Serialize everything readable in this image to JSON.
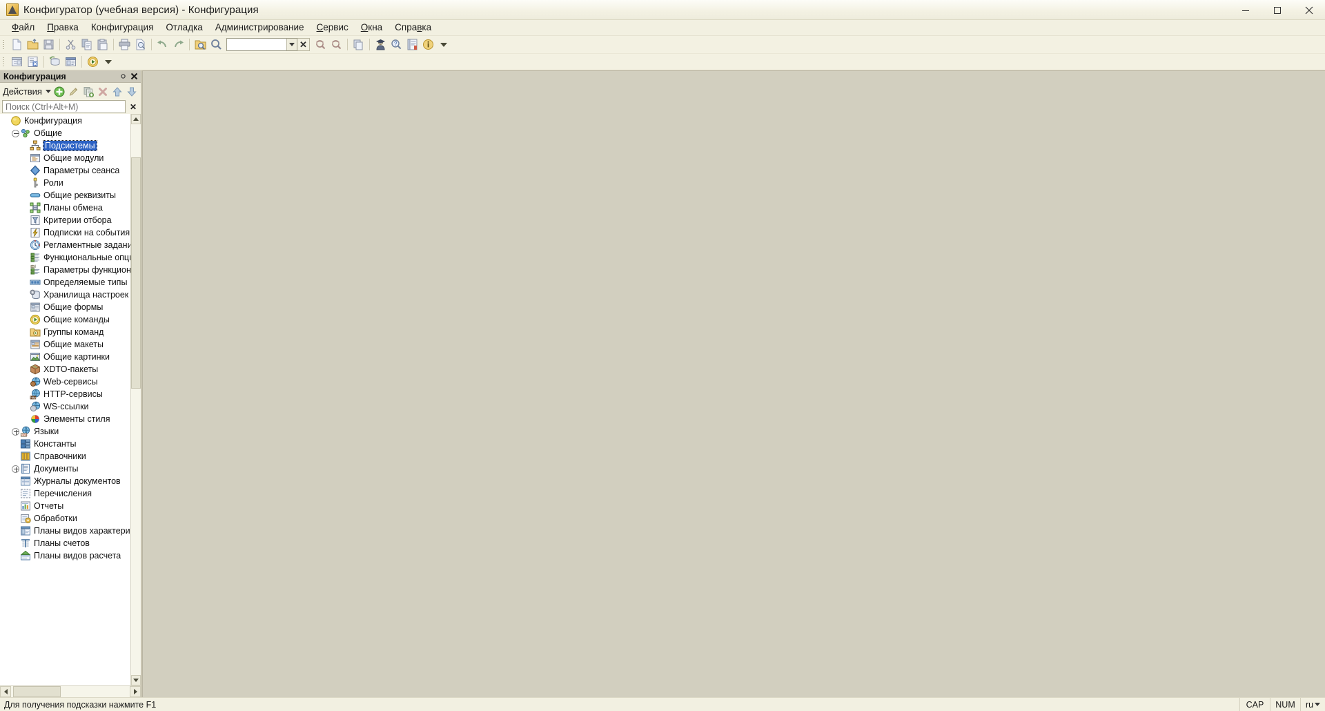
{
  "window": {
    "title": "Конфигуратор (учебная версия) - Конфигурация",
    "app_icon": "1c-configurator-icon",
    "minimize_label": "Свернуть",
    "maximize_label": "Развернуть",
    "close_label": "Закрыть"
  },
  "menu": [
    {
      "label": "Файл",
      "accel": "Ф"
    },
    {
      "label": "Правка",
      "accel": "П"
    },
    {
      "label": "Конфигурация",
      "accel": ""
    },
    {
      "label": "Отладка",
      "accel": ""
    },
    {
      "label": "Администрирование",
      "accel": ""
    },
    {
      "label": "Сервис",
      "accel": "С"
    },
    {
      "label": "Окна",
      "accel": "О"
    },
    {
      "label": "Справка",
      "accel": "в"
    }
  ],
  "toolbar_main": {
    "combo_value": "",
    "items": [
      {
        "name": "new-file-icon",
        "label": "Новый"
      },
      {
        "name": "open-file-icon",
        "label": "Открыть"
      },
      {
        "name": "save-icon",
        "label": "Сохранить"
      },
      {
        "name": "cut-icon",
        "label": "Вырезать"
      },
      {
        "name": "copy-icon",
        "label": "Копировать"
      },
      {
        "name": "paste-icon",
        "label": "Вставить"
      },
      {
        "name": "print-icon",
        "label": "Печать"
      },
      {
        "name": "print-preview-icon",
        "label": "Предварительный просмотр"
      },
      {
        "name": "undo-icon",
        "label": "Отменить"
      },
      {
        "name": "redo-icon",
        "label": "Вернуть"
      },
      {
        "name": "find-in-files-icon",
        "label": "Глобальный поиск"
      },
      {
        "name": "search-icon",
        "label": "Поиск"
      },
      {
        "name": "find-prev-icon",
        "label": "Найти предыдущий"
      },
      {
        "name": "find-next-icon",
        "label": "Найти следующий"
      },
      {
        "name": "windows-icon",
        "label": "Окна"
      },
      {
        "name": "user-icon",
        "label": "Пользователи"
      },
      {
        "name": "help-search-icon",
        "label": "Поиск в справке"
      },
      {
        "name": "syntax-helper-icon",
        "label": "Синтакс-помощник"
      },
      {
        "name": "about-icon",
        "label": "О программе"
      }
    ]
  },
  "toolbar_second": {
    "items": [
      {
        "name": "config-window-icon",
        "label": "Окно конфигурации"
      },
      {
        "name": "config-compare-icon",
        "label": "Сравнить конфигурации"
      },
      {
        "name": "update-db-config-icon",
        "label": "Обновить конфигурацию базы данных"
      },
      {
        "name": "admin-panel-icon",
        "label": "Администрирование"
      },
      {
        "name": "start-debug-icon",
        "label": "Начать отладку"
      }
    ],
    "overflow": "more-icon"
  },
  "panel": {
    "title": "Конфигурация",
    "pin_icon": "pin-icon",
    "close_icon": "close-icon",
    "actions_label": "Действия",
    "action_buttons": [
      {
        "name": "add-button",
        "label": "Добавить"
      },
      {
        "name": "edit-button",
        "label": "Изменить"
      },
      {
        "name": "copy-button",
        "label": "Скопировать"
      },
      {
        "name": "delete-button",
        "label": "Удалить"
      },
      {
        "name": "move-up-button",
        "label": "Переместить вверх"
      },
      {
        "name": "move-down-button",
        "label": "Переместить вниз"
      }
    ],
    "search": {
      "placeholder": "Поиск (Ctrl+Alt+M)",
      "value": "",
      "clear_label": "✕"
    }
  },
  "tree": {
    "selected": "Подсистемы",
    "nodes": [
      {
        "label": "Конфигурация",
        "indent": 0,
        "icon": "config-root-icon",
        "expander": "none",
        "selected": false
      },
      {
        "label": "Общие",
        "indent": 1,
        "icon": "common-icon",
        "expander": "minus",
        "selected": false
      },
      {
        "label": "Подсистемы",
        "indent": 2,
        "icon": "subsystems-icon",
        "expander": "none",
        "selected": true
      },
      {
        "label": "Общие модули",
        "indent": 2,
        "icon": "common-modules-icon",
        "expander": "none",
        "selected": false
      },
      {
        "label": "Параметры сеанса",
        "indent": 2,
        "icon": "session-params-icon",
        "expander": "none",
        "selected": false
      },
      {
        "label": "Роли",
        "indent": 2,
        "icon": "roles-icon",
        "expander": "none",
        "selected": false
      },
      {
        "label": "Общие реквизиты",
        "indent": 2,
        "icon": "common-attributes-icon",
        "expander": "none",
        "selected": false
      },
      {
        "label": "Планы обмена",
        "indent": 2,
        "icon": "exchange-plans-icon",
        "expander": "none",
        "selected": false
      },
      {
        "label": "Критерии отбора",
        "indent": 2,
        "icon": "filter-criteria-icon",
        "expander": "none",
        "selected": false
      },
      {
        "label": "Подписки на события",
        "indent": 2,
        "icon": "event-subscriptions-icon",
        "expander": "none",
        "selected": false
      },
      {
        "label": "Регламентные задания",
        "indent": 2,
        "icon": "scheduled-jobs-icon",
        "expander": "none",
        "selected": false
      },
      {
        "label": "Функциональные опции",
        "indent": 2,
        "icon": "functional-options-icon",
        "expander": "none",
        "selected": false
      },
      {
        "label": "Параметры функциональных опций",
        "indent": 2,
        "icon": "functional-option-params-icon",
        "expander": "none",
        "selected": false
      },
      {
        "label": "Определяемые типы",
        "indent": 2,
        "icon": "defined-types-icon",
        "expander": "none",
        "selected": false
      },
      {
        "label": "Хранилища настроек",
        "indent": 2,
        "icon": "settings-storages-icon",
        "expander": "none",
        "selected": false
      },
      {
        "label": "Общие формы",
        "indent": 2,
        "icon": "common-forms-icon",
        "expander": "none",
        "selected": false
      },
      {
        "label": "Общие команды",
        "indent": 2,
        "icon": "common-commands-icon",
        "expander": "none",
        "selected": false
      },
      {
        "label": "Группы команд",
        "indent": 2,
        "icon": "command-groups-icon",
        "expander": "none",
        "selected": false
      },
      {
        "label": "Общие макеты",
        "indent": 2,
        "icon": "common-templates-icon",
        "expander": "none",
        "selected": false
      },
      {
        "label": "Общие картинки",
        "indent": 2,
        "icon": "common-pictures-icon",
        "expander": "none",
        "selected": false
      },
      {
        "label": "XDTO-пакеты",
        "indent": 2,
        "icon": "xdto-packages-icon",
        "expander": "none",
        "selected": false
      },
      {
        "label": "Web-сервисы",
        "indent": 2,
        "icon": "web-services-icon",
        "expander": "none",
        "selected": false
      },
      {
        "label": "HTTP-сервисы",
        "indent": 2,
        "icon": "http-services-icon",
        "expander": "none",
        "selected": false
      },
      {
        "label": "WS-ссылки",
        "indent": 2,
        "icon": "ws-links-icon",
        "expander": "none",
        "selected": false
      },
      {
        "label": "Элементы стиля",
        "indent": 2,
        "icon": "style-elements-icon",
        "expander": "none",
        "selected": false
      },
      {
        "label": "Языки",
        "indent": 1,
        "icon": "languages-icon",
        "expander": "plus",
        "selected": false
      },
      {
        "label": "Константы",
        "indent": 1,
        "icon": "constants-icon",
        "expander": "none",
        "selected": false
      },
      {
        "label": "Справочники",
        "indent": 1,
        "icon": "catalogs-icon",
        "expander": "none",
        "selected": false
      },
      {
        "label": "Документы",
        "indent": 1,
        "icon": "documents-icon",
        "expander": "plus",
        "selected": false
      },
      {
        "label": "Журналы документов",
        "indent": 1,
        "icon": "document-journals-icon",
        "expander": "none",
        "selected": false
      },
      {
        "label": "Перечисления",
        "indent": 1,
        "icon": "enums-icon",
        "expander": "none",
        "selected": false
      },
      {
        "label": "Отчеты",
        "indent": 1,
        "icon": "reports-icon",
        "expander": "none",
        "selected": false
      },
      {
        "label": "Обработки",
        "indent": 1,
        "icon": "data-processors-icon",
        "expander": "none",
        "selected": false
      },
      {
        "label": "Планы видов характеристик",
        "indent": 1,
        "icon": "chart-of-characteristic-types-icon",
        "expander": "none",
        "selected": false
      },
      {
        "label": "Планы счетов",
        "indent": 1,
        "icon": "chart-of-accounts-icon",
        "expander": "none",
        "selected": false
      },
      {
        "label": "Планы видов расчета",
        "indent": 1,
        "icon": "chart-of-calculation-types-icon",
        "expander": "none",
        "selected": false
      }
    ]
  },
  "statusbar": {
    "message": "Для получения подсказки нажмите F1",
    "cap": "CAP",
    "num": "NUM",
    "lang": "ru"
  },
  "colors": {
    "selection": "#2b61c4",
    "chrome": "#f3f1e2",
    "workspace": "#d2cfbf",
    "panel_header": "#ccc9bb"
  }
}
